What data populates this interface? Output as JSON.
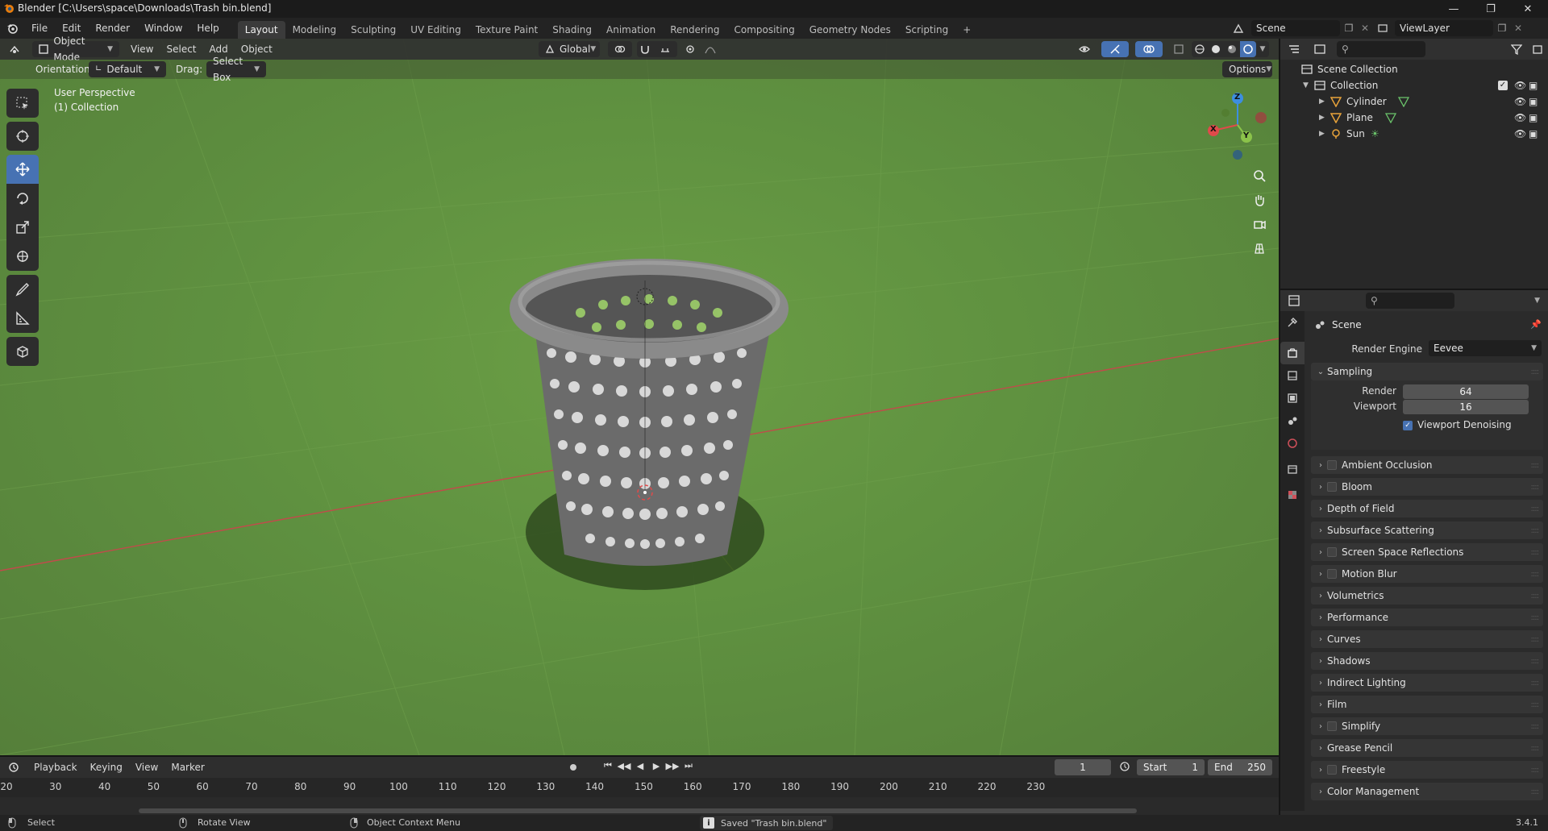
{
  "titlebar": {
    "title": "Blender [C:\\Users\\space\\Downloads\\Trash bin.blend]"
  },
  "menu": {
    "items": [
      "File",
      "Edit",
      "Render",
      "Window",
      "Help"
    ],
    "workspaces": [
      "Layout",
      "Modeling",
      "Sculpting",
      "UV Editing",
      "Texture Paint",
      "Shading",
      "Animation",
      "Rendering",
      "Compositing",
      "Geometry Nodes",
      "Scripting"
    ],
    "active_workspace": "Layout",
    "add_tab": "+",
    "scene": "Scene",
    "view_layer": "ViewLayer"
  },
  "viewport": {
    "mode": "Object Mode",
    "menus": [
      "View",
      "Select",
      "Add",
      "Object"
    ],
    "transform": "Global",
    "orientation_label": "Orientation:",
    "orientation": "Default",
    "drag_label": "Drag:",
    "drag": "Select Box",
    "options": "Options",
    "perspective": "User Perspective",
    "collection": "(1) Collection",
    "gizmo": {
      "x": "X",
      "y": "Y",
      "z": "Z"
    }
  },
  "outliner": {
    "root": "Scene Collection",
    "collection": "Collection",
    "objects": [
      {
        "name": "Cylinder",
        "type": "mesh"
      },
      {
        "name": "Plane",
        "type": "mesh"
      },
      {
        "name": "Sun",
        "type": "light"
      }
    ]
  },
  "properties": {
    "context": "Scene",
    "render_engine_label": "Render Engine",
    "render_engine": "Eevee",
    "sampling": {
      "title": "Sampling",
      "render_label": "Render",
      "render": "64",
      "viewport_label": "Viewport",
      "viewport": "16",
      "denoise_label": "Viewport Denoising",
      "denoise": true
    },
    "panels": [
      {
        "label": "Ambient Occlusion",
        "checkbox": true
      },
      {
        "label": "Bloom",
        "checkbox": true
      },
      {
        "label": "Depth of Field",
        "checkbox": false
      },
      {
        "label": "Subsurface Scattering",
        "checkbox": false
      },
      {
        "label": "Screen Space Reflections",
        "checkbox": true
      },
      {
        "label": "Motion Blur",
        "checkbox": true
      },
      {
        "label": "Volumetrics",
        "checkbox": false
      },
      {
        "label": "Performance",
        "checkbox": false
      },
      {
        "label": "Curves",
        "checkbox": false
      },
      {
        "label": "Shadows",
        "checkbox": false
      },
      {
        "label": "Indirect Lighting",
        "checkbox": false
      },
      {
        "label": "Film",
        "checkbox": false
      },
      {
        "label": "Simplify",
        "checkbox": true
      },
      {
        "label": "Grease Pencil",
        "checkbox": false
      },
      {
        "label": "Freestyle",
        "checkbox": true
      },
      {
        "label": "Color Management",
        "checkbox": false
      }
    ]
  },
  "timeline": {
    "menus": [
      "Playback",
      "Keying",
      "View",
      "Marker"
    ],
    "current_frame": "1",
    "start_label": "Start",
    "start": "1",
    "end_label": "End",
    "end": "250",
    "ticks": [
      "20",
      "30",
      "40",
      "50",
      "60",
      "70",
      "80",
      "90",
      "100",
      "110",
      "120",
      "130",
      "140",
      "150",
      "160",
      "170",
      "180",
      "190",
      "200",
      "210",
      "220",
      "230"
    ]
  },
  "status": {
    "select": "Select",
    "rotate": "Rotate View",
    "context_menu": "Object Context Menu",
    "message": "Saved \"Trash bin.blend\"",
    "version": "3.4.1"
  },
  "colors": {
    "accent": "#4772b3",
    "viewport_bg": "#5f9140",
    "axis_x": "#e04a4a",
    "axis_y": "#8bc34a",
    "axis_z": "#3d8ee0"
  }
}
